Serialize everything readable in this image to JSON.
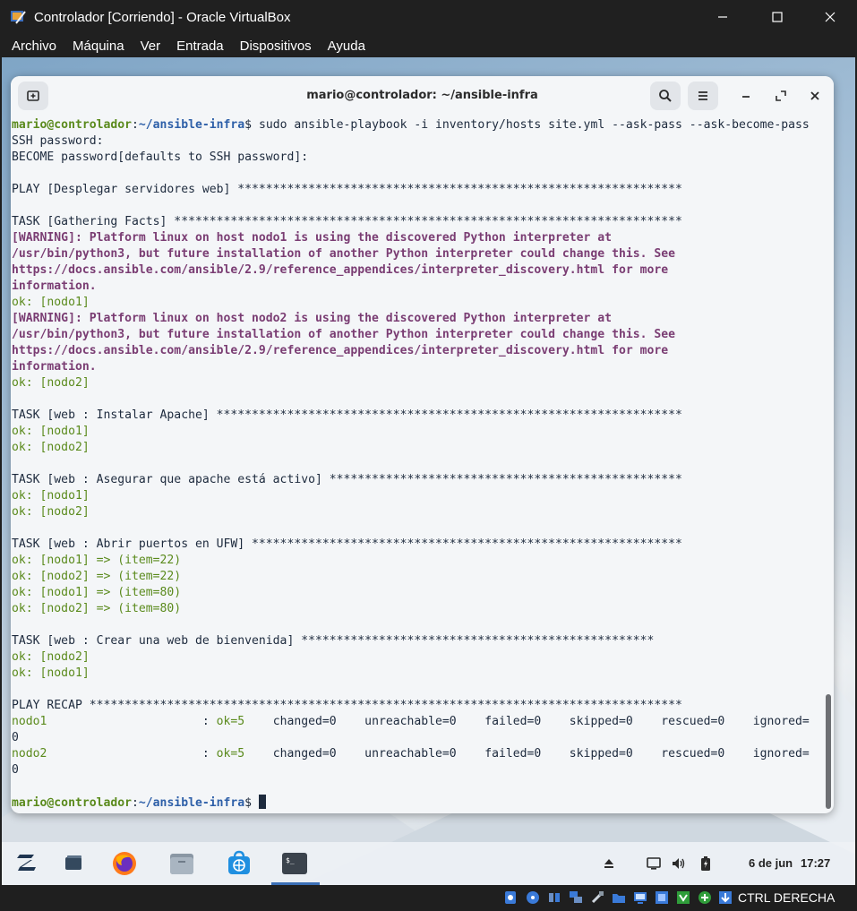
{
  "vbox": {
    "title": "Controlador [Corriendo] - Oracle VirtualBox",
    "menu": [
      "Archivo",
      "Máquina",
      "Ver",
      "Entrada",
      "Dispositivos",
      "Ayuda"
    ],
    "host_key": "CTRL DERECHA"
  },
  "terminal": {
    "title": "mario@controlador: ~/ansible-infra",
    "prompt_user": "mario@controlador",
    "prompt_path": "~/ansible-infra",
    "command": "sudo ansible-playbook -i inventory/hosts site.yml --ask-pass --ask-become-pass",
    "lines": [
      {
        "k": "prompt"
      },
      {
        "t": "SSH password:"
      },
      {
        "t": "BECOME password[defaults to SSH password]:"
      },
      {
        "t": ""
      },
      {
        "t": "PLAY [Desplegar servidores web] ***************************************************************"
      },
      {
        "t": ""
      },
      {
        "t": "TASK [Gathering Facts] ************************************************************************"
      },
      {
        "t": "[WARNING]: Platform linux on host nodo1 is using the discovered Python interpreter at",
        "c": "warn"
      },
      {
        "t": "/usr/bin/python3, but future installation of another Python interpreter could change this. See",
        "c": "warn"
      },
      {
        "t": "https://docs.ansible.com/ansible/2.9/reference_appendices/interpreter_discovery.html for more",
        "c": "warn"
      },
      {
        "t": "information.",
        "c": "warn"
      },
      {
        "t": "ok: [nodo1]",
        "c": "ok"
      },
      {
        "t": "[WARNING]: Platform linux on host nodo2 is using the discovered Python interpreter at",
        "c": "warn"
      },
      {
        "t": "/usr/bin/python3, but future installation of another Python interpreter could change this. See",
        "c": "warn"
      },
      {
        "t": "https://docs.ansible.com/ansible/2.9/reference_appendices/interpreter_discovery.html for more",
        "c": "warn"
      },
      {
        "t": "information.",
        "c": "warn"
      },
      {
        "t": "ok: [nodo2]",
        "c": "ok"
      },
      {
        "t": ""
      },
      {
        "t": "TASK [web : Instalar Apache] ******************************************************************"
      },
      {
        "t": "ok: [nodo1]",
        "c": "ok"
      },
      {
        "t": "ok: [nodo2]",
        "c": "ok"
      },
      {
        "t": ""
      },
      {
        "t": "TASK [web : Asegurar que apache está activo] **************************************************"
      },
      {
        "t": "ok: [nodo1]",
        "c": "ok"
      },
      {
        "t": "ok: [nodo2]",
        "c": "ok"
      },
      {
        "t": ""
      },
      {
        "t": "TASK [web : Abrir puertos en UFW] *************************************************************"
      },
      {
        "t": "ok: [nodo1] => (item=22)",
        "c": "ok"
      },
      {
        "t": "ok: [nodo2] => (item=22)",
        "c": "ok"
      },
      {
        "t": "ok: [nodo1] => (item=80)",
        "c": "ok"
      },
      {
        "t": "ok: [nodo2] => (item=80)",
        "c": "ok"
      },
      {
        "t": ""
      },
      {
        "t": "TASK [web : Crear una web de bienvenida] **************************************************"
      },
      {
        "t": "ok: [nodo2]",
        "c": "ok"
      },
      {
        "t": "ok: [nodo1]",
        "c": "ok"
      },
      {
        "t": ""
      },
      {
        "t": "PLAY RECAP ************************************************************************************"
      },
      {
        "k": "recap",
        "host": "nodo1",
        "pad": "                      : ",
        "ok": "ok=5",
        "rest": "    changed=0    unreachable=0    failed=0    skipped=0    rescued=0    ignored="
      },
      {
        "t": "0"
      },
      {
        "k": "recap",
        "host": "nodo2",
        "pad": "                      : ",
        "ok": "ok=5",
        "rest": "    changed=0    unreachable=0    failed=0    skipped=0    rescued=0    ignored="
      },
      {
        "t": "0"
      },
      {
        "t": ""
      },
      {
        "k": "prompt_end"
      }
    ]
  },
  "taskbar": {
    "date": "6 de jun",
    "time": "17:27",
    "apps": [
      "zorin-menu-icon",
      "show-desktop-icon",
      "firefox-icon",
      "files-icon",
      "software-store-icon",
      "terminal-icon"
    ],
    "tray": [
      "eject-icon",
      "screen-icon",
      "volume-icon",
      "battery-icon"
    ]
  },
  "colors": {
    "prompt_user": "#5a8a1c",
    "prompt_path": "#2d5fa8",
    "warning": "#7a3d73",
    "ok": "#5a8a1c",
    "text": "#1d2a3d"
  }
}
